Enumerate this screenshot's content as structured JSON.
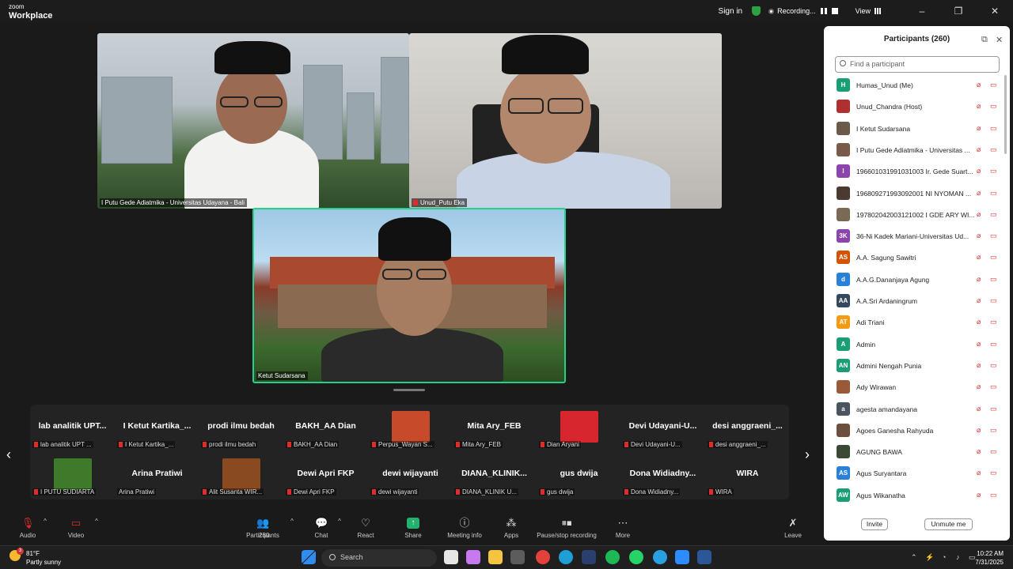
{
  "app": {
    "logo_line1": "zoom",
    "logo_line2": "Workplace"
  },
  "titlebar": {
    "sign_in": "Sign in",
    "recording": "Recording...",
    "view": "View",
    "minimize": "–",
    "restore": "❐",
    "close": "✕"
  },
  "video": {
    "tile1_name": "I Putu Gede Adiatmika - Universitas Udayana - Bali",
    "tile2_name": "Unud_Putu Eka",
    "tile3_name": "Ketut Sudarsana"
  },
  "gallery": {
    "row1": [
      {
        "big": "lab analitik UPT...",
        "small": "lab analitik UPT ..."
      },
      {
        "big": "I Ketut Kartika_...",
        "small": "I Ketut Kartika_..."
      },
      {
        "big": "prodi ilmu bedah",
        "small": "prodi ilmu bedah"
      },
      {
        "big": "BAKH_AA Dian",
        "small": "BAKH_AA Dian"
      },
      {
        "big": "",
        "small": "Perpus_Wayan S..."
      },
      {
        "big": "Mita Ary_FEB",
        "small": "Mita Ary_FEB"
      },
      {
        "big": "",
        "small": "Dian Aryani"
      },
      {
        "big": "Devi Udayani-U...",
        "small": "Devi Udayani-U..."
      },
      {
        "big": "desi anggraeni_...",
        "small": "desi anggraeni_..."
      }
    ],
    "row2": [
      {
        "big": "",
        "small": "I PUTU SUDIARTA"
      },
      {
        "big": "Arina Pratiwi",
        "small": "Arina Pratiwi"
      },
      {
        "big": "",
        "small": "Alit Susanta WIR..."
      },
      {
        "big": "Dewi Apri FKP",
        "small": "Dewi Apri FKP"
      },
      {
        "big": "dewi wijayanti",
        "small": "dewi wijayanti"
      },
      {
        "big": "DIANA_KLINIK...",
        "small": "DIANA_KLINIK U..."
      },
      {
        "big": "gus dwija",
        "small": "gus dwija"
      },
      {
        "big": "Dona Widiadny...",
        "small": "Dona Widiadny..."
      },
      {
        "big": "WIRA",
        "small": "WIRA"
      }
    ],
    "prev": "‹",
    "next": "›"
  },
  "toolbar": {
    "audio": "Audio",
    "video": "Video",
    "participants": "Participants",
    "participants_count": "260",
    "chat": "Chat",
    "react": "React",
    "share": "Share",
    "meeting_info": "Meeting info",
    "apps": "Apps",
    "record": "Pause/stop recording",
    "more": "More",
    "leave": "Leave"
  },
  "panel": {
    "title": "Participants (260)",
    "search_placeholder": "Find a participant",
    "invite": "Invite",
    "unmute_me": "Unmute me",
    "participants": [
      {
        "initials": "H",
        "color": "#1a9e75",
        "name": "Humas_Unud (Me)"
      },
      {
        "initials": "",
        "color": "#b03030",
        "name": "Unud_Chandra (Host)"
      },
      {
        "initials": "",
        "color": "#6b5a4a",
        "name": "I Ketut Sudarsana"
      },
      {
        "initials": "",
        "color": "#7a5a48",
        "name": "I Putu Gede Adiatmika - Universitas ..."
      },
      {
        "initials": "I",
        "color": "#8e44ad",
        "name": "196601031991031003 Ir. Gede Suart..."
      },
      {
        "initials": "",
        "color": "#4a3a30",
        "name": "196809271993092001 NI NYOMAN ..."
      },
      {
        "initials": "",
        "color": "#7a6a55",
        "name": "197802042003121002 I GDE ARY WI..."
      },
      {
        "initials": "3K",
        "color": "#8e44ad",
        "name": "36-Ni Kadek Mariani-Universitas Ud..."
      },
      {
        "initials": "AS",
        "color": "#d35400",
        "name": "A.A. Sagung Sawitri"
      },
      {
        "initials": "d",
        "color": "#2980d9",
        "name": "A.A.G.Dananjaya Agung"
      },
      {
        "initials": "AA",
        "color": "#34495e",
        "name": "A.A.Sri Ardaningrum"
      },
      {
        "initials": "AT",
        "color": "#f39c12",
        "name": "Adi Triani"
      },
      {
        "initials": "A",
        "color": "#1a9e75",
        "name": "Admin"
      },
      {
        "initials": "AN",
        "color": "#1a9e75",
        "name": "Admini Nengah Punia"
      },
      {
        "initials": "",
        "color": "#9a5a3a",
        "name": "Ady Wirawan"
      },
      {
        "initials": "a",
        "color": "#4a5560",
        "name": "agesta amandayana"
      },
      {
        "initials": "",
        "color": "#6b5040",
        "name": "Agoes Ganesha Rahyuda"
      },
      {
        "initials": "",
        "color": "#3a4a35",
        "name": "AGUNG BAWA"
      },
      {
        "initials": "AS",
        "color": "#2980d9",
        "name": "Agus Suryantara"
      },
      {
        "initials": "AW",
        "color": "#1a9e75",
        "name": "Agus Wikanatha"
      }
    ]
  },
  "taskbar": {
    "temp": "81°F",
    "weather": "Partly sunny",
    "weather_badge": "3",
    "search": "Search",
    "time": "10:22 AM",
    "date": "7/31/2025"
  },
  "colors": {
    "accent": "#23d18b",
    "muted": "#e02b2b"
  }
}
